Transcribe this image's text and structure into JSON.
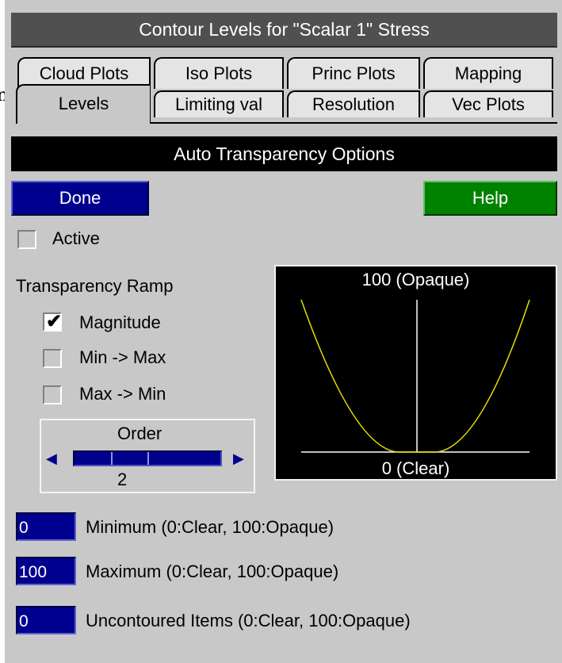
{
  "window": {
    "title": "Contour Levels for \"Scalar 1\" Stress"
  },
  "stray_glyph": "n",
  "tabs": {
    "back_row": [
      "Cloud Plots",
      "Iso Plots",
      "Princ Plots",
      "Mapping"
    ],
    "front_row": [
      "Levels",
      "Limiting val",
      "Resolution",
      "Vec Plots"
    ],
    "active": "Levels"
  },
  "section": {
    "title": "Auto Transparency Options"
  },
  "buttons": {
    "done": "Done",
    "help": "Help"
  },
  "active_toggle": {
    "label": "Active",
    "checked": false
  },
  "ramp": {
    "heading": "Transparency Ramp",
    "options": [
      {
        "label": "Magnitude",
        "checked": true
      },
      {
        "label": "Min -> Max",
        "checked": false
      },
      {
        "label": "Max -> Min",
        "checked": false
      }
    ]
  },
  "order": {
    "label": "Order",
    "value": "2",
    "left_icon": "triangle-left-icon",
    "right_icon": "triangle-right-icon"
  },
  "graph": {
    "top_label": "100 (Opaque)",
    "bottom_label": "0 (Clear)",
    "curve_color": "#e8e000"
  },
  "fields": [
    {
      "value": "0",
      "label": "Minimum (0:Clear, 100:Opaque)"
    },
    {
      "value": "100",
      "label": "Maximum (0:Clear, 100:Opaque)"
    },
    {
      "value": "0",
      "label": "Uncontoured Items (0:Clear, 100:Opaque)"
    }
  ],
  "colors": {
    "panel": "#c8c8c8",
    "button_blue": "#00008e",
    "button_green": "#008200",
    "title_bar": "#505050"
  }
}
